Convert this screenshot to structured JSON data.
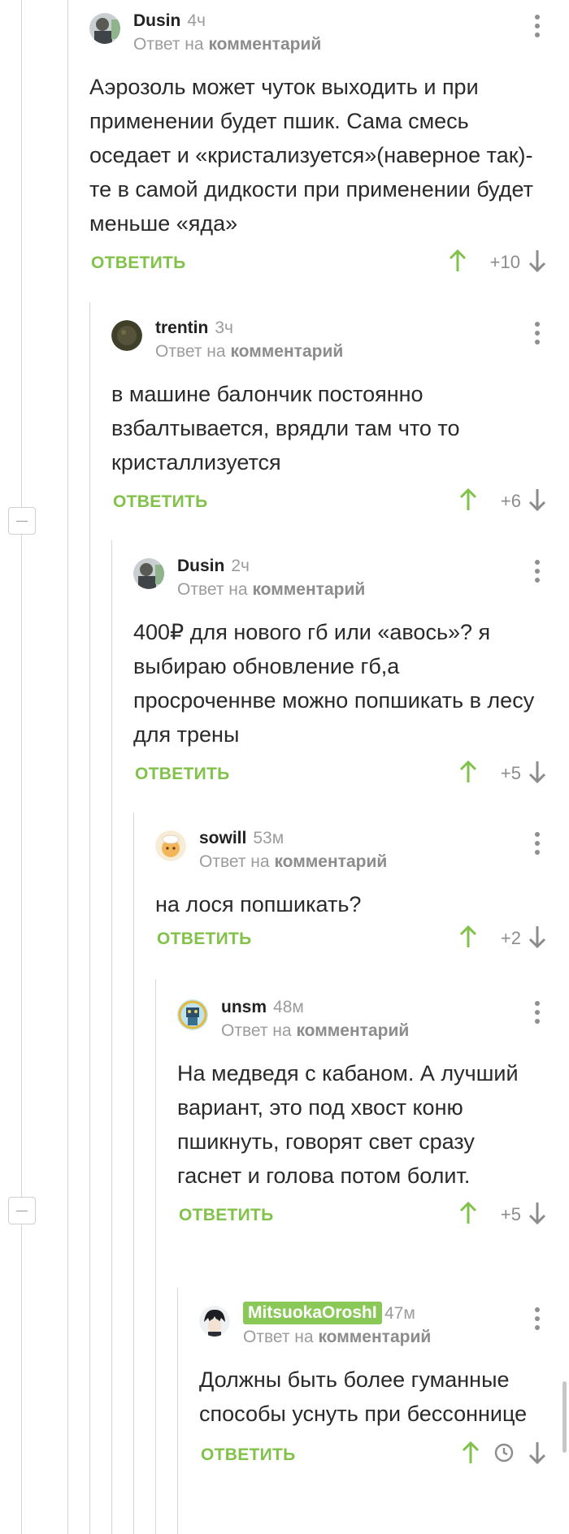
{
  "colors": {
    "accent": "#82c24a",
    "muted": "#9c9c9c",
    "line": "#d6d6d6"
  },
  "reply_label": "ОТВЕТИТЬ",
  "reply_to_prefix": "Ответ на",
  "reply_to_target": "комментарий",
  "comments": [
    {
      "user": "Dusin",
      "time": "4ч",
      "text": "Аэрозоль может чуток выходить и при применении будет пшик. Сама смесь оседает и «кристализуется»(наверное так)-те в самой дидкости при применении будет меньше «яда»",
      "score": "+10",
      "avatar_icon": "user-photo-icon"
    },
    {
      "user": "trentin",
      "time": "3ч",
      "text": "в машине балончик постоянно взбалтывается, врядли там что то кристаллизуется",
      "score": "+6",
      "avatar_icon": "dark-circle-avatar-icon"
    },
    {
      "user": "Dusin",
      "time": "2ч",
      "text": "400₽ для нового гб или «авось»? я выбираю обновление гб,а просроченнве можно попшикать в лесу для трены",
      "score": "+5",
      "avatar_icon": "user-photo-icon"
    },
    {
      "user": "sowill",
      "time": "53м",
      "text": "на лося попшикать?",
      "score": "+2",
      "avatar_icon": "cartoon-face-icon"
    },
    {
      "user": "unsm",
      "time": "48м",
      "text": "На медведя с кабаном. А лучший вариант, это под хвост коню пшикнуть, говорят свет сразу гаснет и голова потом болит.",
      "score": "+5",
      "avatar_icon": "cartoon-robot-icon"
    },
    {
      "user": "MitsuokaOroshI",
      "time": "47м",
      "text": "Должны быть более гуманные способы уснуть при бессоннице",
      "score": "",
      "avatar_icon": "anime-avatar-icon",
      "score_icon": "clock-icon"
    }
  ]
}
